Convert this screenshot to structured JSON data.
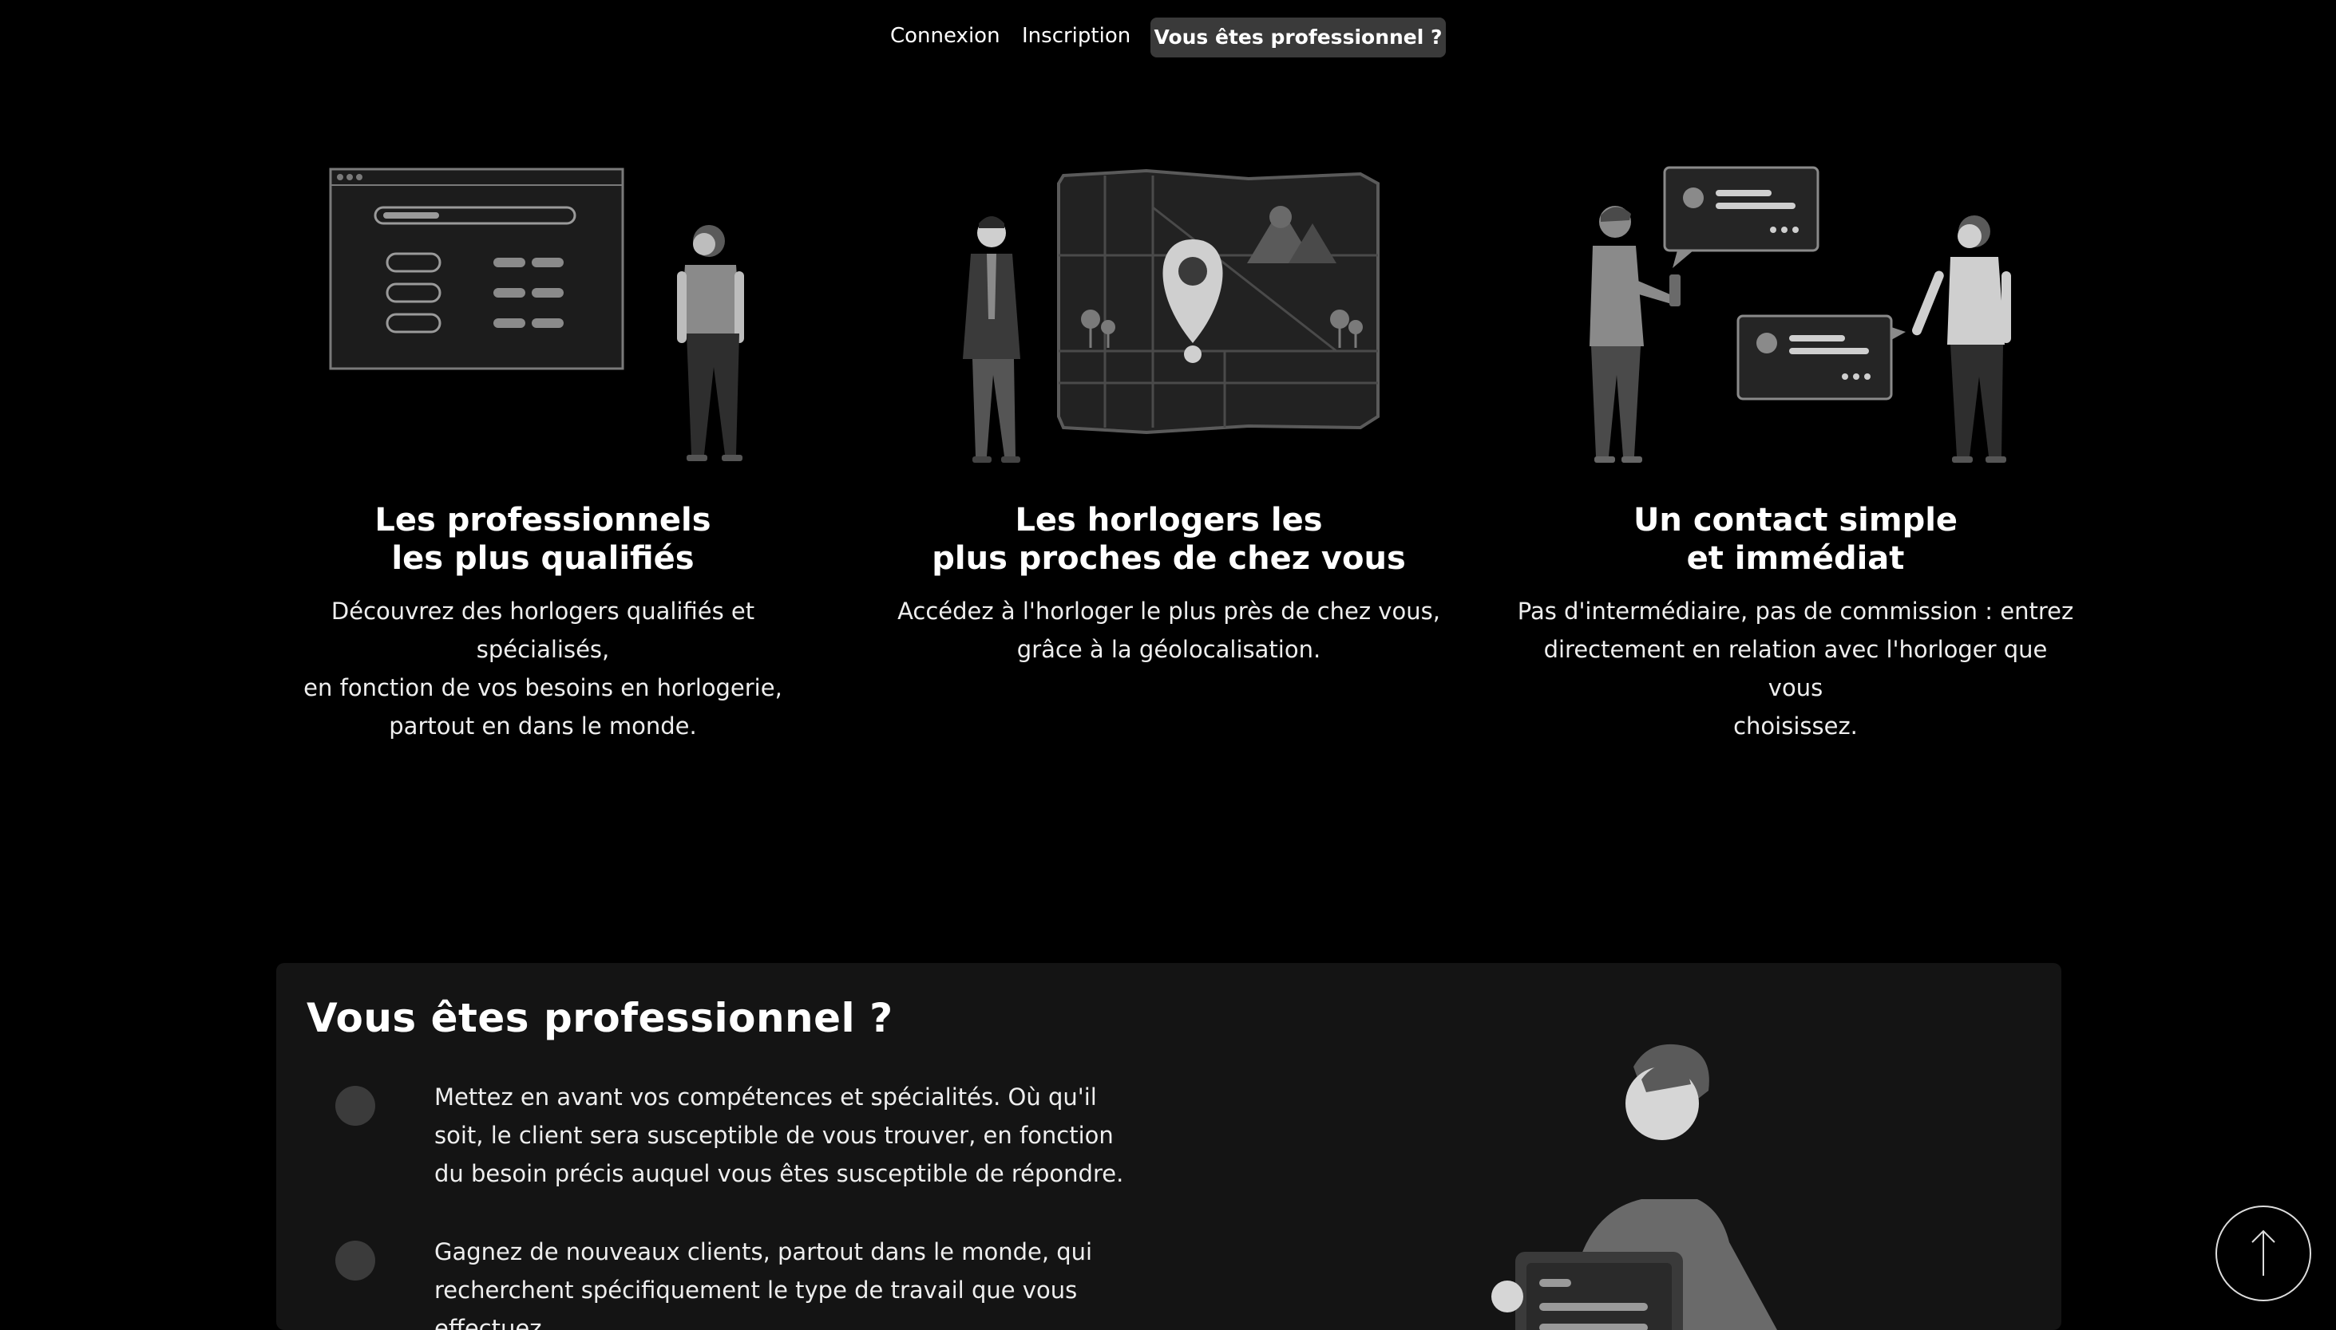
{
  "nav": {
    "login": "Connexion",
    "signup": "Inscription",
    "pro": "Vous êtes professionnel ?"
  },
  "features": [
    {
      "title": "Les professionnels\nles plus qualifiés",
      "text": "Découvrez des horlogers qualifiés et spécialisés,\nen fonction de vos besoins en horlogerie,\npartout en dans le monde.",
      "illustration": "browser-search-person"
    },
    {
      "title": "Les horlogers les\nplus proches de chez vous",
      "text": "Accédez à l'horloger le plus près de chez vous,\ngrâce à la géolocalisation.",
      "illustration": "map-pin-person"
    },
    {
      "title": "Un contact simple\net immédiat",
      "text": "Pas d'intermédiaire, pas de commission : entrez\ndirectement en relation avec l'horloger que vous\nchoisissez.",
      "illustration": "chat-two-people"
    }
  ],
  "pro_section": {
    "title": "Vous êtes professionnel  ?",
    "items": [
      "Mettez en avant vos compétences et spécialités. Où qu'il soit, le client sera susceptible de vous trouver, en fonction du besoin précis auquel vous êtes susceptible de répondre.",
      "Gagnez de nouveaux clients, partout dans le monde, qui recherchent spécifiquement le type de travail que vous effectuez."
    ]
  },
  "colors": {
    "background": "#000000",
    "card": "#141414",
    "button": "#3a3a3a",
    "illustration_gray": "#6b6b6b"
  }
}
